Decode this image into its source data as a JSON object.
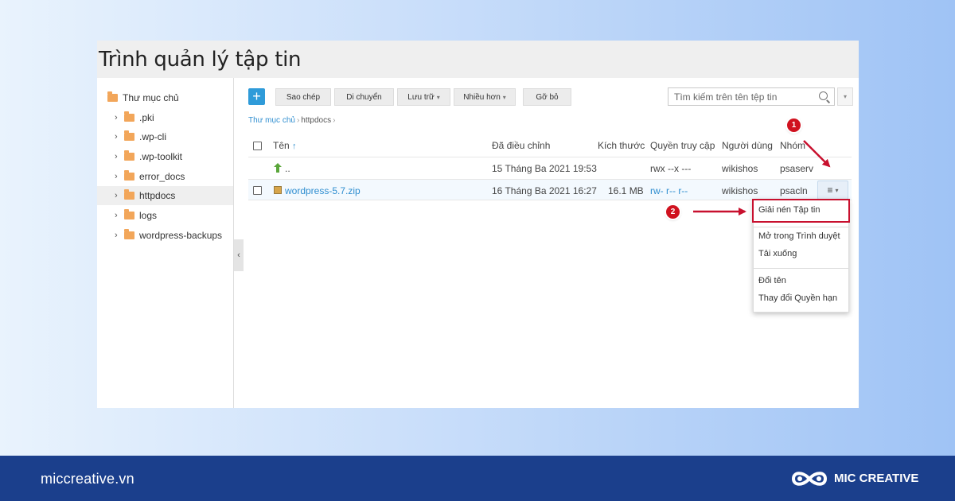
{
  "panel": {
    "title": "Trình quản lý tập tin"
  },
  "sidebar": {
    "root": "Thư mục chủ",
    "items": [
      {
        "label": ".pki"
      },
      {
        "label": ".wp-cli"
      },
      {
        "label": ".wp-toolkit"
      },
      {
        "label": "error_docs"
      },
      {
        "label": "httpdocs"
      },
      {
        "label": "logs"
      },
      {
        "label": "wordpress-backups"
      }
    ],
    "collapse_glyph": "‹"
  },
  "toolbar": {
    "add_glyph": "+",
    "copy": "Sao chép",
    "move": "Di chuyển",
    "archive": "Lưu trữ",
    "more": "Nhiều hơn",
    "remove": "Gỡ bỏ",
    "search_placeholder": "Tìm kiếm trên tên tệp tin"
  },
  "breadcrumb": {
    "root": "Thư mục chủ",
    "current": "httpdocs"
  },
  "table": {
    "headers": {
      "name": "Tên",
      "sort_glyph": "↑",
      "modified": "Đã điều chỉnh",
      "size": "Kích thước",
      "permissions": "Quyền truy cập",
      "user": "Người dùng",
      "group": "Nhóm"
    },
    "rows": [
      {
        "name": "..",
        "modified": "15 Tháng Ba 2021 19:53",
        "size": "",
        "permissions": "rwx --x ---",
        "user": "wikishos",
        "group": "psaserv"
      },
      {
        "name": "wordpress-5.7.zip",
        "modified": "16 Tháng Ba 2021 16:27",
        "size": "16.1 MB",
        "permissions": "rw- r-- r--",
        "user": "wikishos",
        "group": "psacln"
      }
    ]
  },
  "context_menu": {
    "items": [
      {
        "label": "Giải nén Tập tin"
      },
      {
        "label": "Mở trong Trình duyệt"
      },
      {
        "label": "Tải xuống"
      },
      {
        "label": "Đổi tên"
      },
      {
        "label": "Thay đổi Quyền hạn"
      }
    ]
  },
  "annotations": {
    "badge1": "1",
    "badge2": "2",
    "accent": "#c8102e"
  },
  "footer": {
    "url": "miccreative.vn",
    "brand": "MIC CREATIVE"
  }
}
